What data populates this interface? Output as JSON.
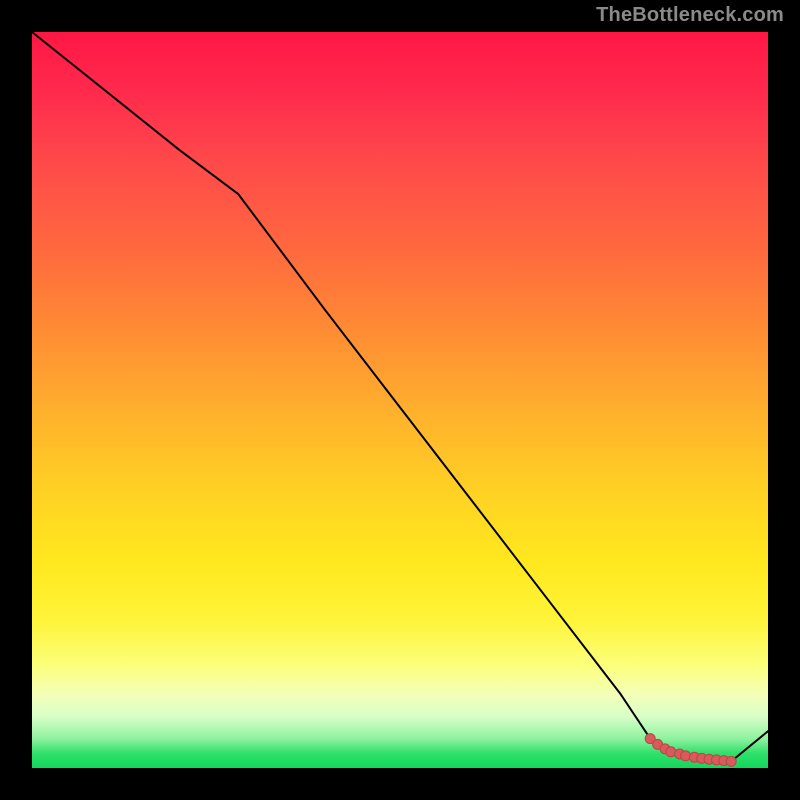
{
  "watermark": "TheBottleneck.com",
  "colors": {
    "line": "#000000",
    "dots": "#d85a5a",
    "dot_stroke": "#b94646",
    "bg_black": "#000000"
  },
  "chart_data": {
    "type": "line",
    "title": "",
    "xlabel": "",
    "ylabel": "",
    "xlim": [
      0,
      100
    ],
    "ylim": [
      0,
      100
    ],
    "grid": false,
    "legend": false,
    "series": [
      {
        "name": "curve",
        "x": [
          0,
          10,
          20,
          28,
          40,
          50,
          60,
          70,
          80,
          84,
          86,
          88,
          90,
          92,
          94,
          95,
          100
        ],
        "y": [
          100,
          92,
          84,
          78,
          62,
          49,
          36,
          23,
          10,
          4,
          2.5,
          1.8,
          1.3,
          1.0,
          0.9,
          0.9,
          5
        ],
        "style": "solid-then-dotted",
        "dotted_from_index": 9
      }
    ],
    "dots": {
      "name": "floor-dots",
      "x": [
        84,
        85,
        86,
        86.8,
        88,
        88.8,
        90,
        91,
        92,
        93,
        94,
        95
      ],
      "y": [
        4.0,
        3.2,
        2.6,
        2.2,
        1.9,
        1.65,
        1.45,
        1.3,
        1.2,
        1.1,
        1.0,
        0.9
      ]
    }
  }
}
